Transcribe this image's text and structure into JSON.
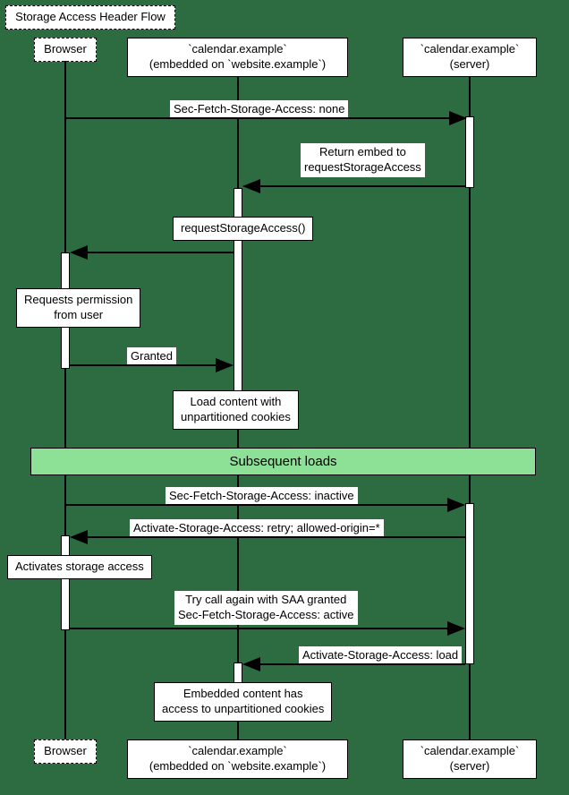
{
  "title": "Storage Access Header Flow",
  "participants": {
    "browser": "Browser",
    "embed_line1": "`calendar.example`",
    "embed_line2": "(embedded on `website.example`)",
    "server_line1": "`calendar.example`",
    "server_line2": "(server)"
  },
  "messages": {
    "m1": "Sec-Fetch-Storage-Access: none",
    "m2_line1": "Return embed to",
    "m2_line2": "requestStorageAccess",
    "m3": "requestStorageAccess()",
    "m4_line1": "Requests permission",
    "m4_line2": "from user",
    "m5": "Granted",
    "m6_line1": "Load content with",
    "m6_line2": "unpartitioned cookies",
    "divider": "Subsequent loads",
    "m7": "Sec-Fetch-Storage-Access: inactive",
    "m8": "Activate-Storage-Access: retry; allowed-origin=*",
    "m9": "Activates storage access",
    "m10_line1": "Try call again with SAA granted",
    "m10_line2": "Sec-Fetch-Storage-Access: active",
    "m11": "Activate-Storage-Access: load",
    "m12_line1": "Embedded content has",
    "m12_line2": "access to unpartitioned cookies"
  },
  "chart_data": {
    "type": "sequence-diagram",
    "title": "Storage Access Header Flow",
    "participants": [
      {
        "id": "browser",
        "name": "Browser"
      },
      {
        "id": "embed",
        "name": "`calendar.example` (embedded on `website.example`)"
      },
      {
        "id": "server",
        "name": "`calendar.example` (server)"
      }
    ],
    "interactions": [
      {
        "from": "browser",
        "to": "server",
        "label": "Sec-Fetch-Storage-Access: none"
      },
      {
        "from": "server",
        "to": "embed",
        "label": "Return embed to requestStorageAccess"
      },
      {
        "from": "embed",
        "to": "browser",
        "label": "requestStorageAccess()"
      },
      {
        "type": "note",
        "on": "browser",
        "label": "Requests permission from user"
      },
      {
        "from": "browser",
        "to": "embed",
        "label": "Granted"
      },
      {
        "type": "note",
        "on": "embed",
        "label": "Load content with unpartitioned cookies"
      },
      {
        "type": "divider",
        "label": "Subsequent loads"
      },
      {
        "from": "browser",
        "to": "server",
        "label": "Sec-Fetch-Storage-Access: inactive"
      },
      {
        "from": "server",
        "to": "browser",
        "label": "Activate-Storage-Access: retry; allowed-origin=*"
      },
      {
        "type": "note",
        "on": "browser",
        "label": "Activates storage access"
      },
      {
        "from": "browser",
        "to": "server",
        "label": "Try call again with SAA granted\nSec-Fetch-Storage-Access: active"
      },
      {
        "from": "server",
        "to": "embed",
        "label": "Activate-Storage-Access: load"
      },
      {
        "type": "note",
        "on": "embed",
        "label": "Embedded content has access to unpartitioned cookies"
      }
    ]
  }
}
